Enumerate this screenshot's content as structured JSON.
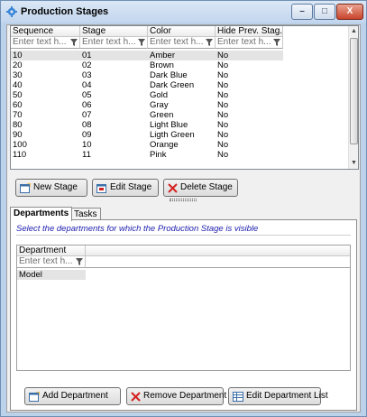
{
  "window": {
    "title": "Production Stages",
    "minimize_glyph": "–",
    "maximize_glyph": "□",
    "close_glyph": "X"
  },
  "stages_grid": {
    "columns": [
      "Sequence",
      "Stage",
      "Color",
      "Hide Prev. Stag..."
    ],
    "filter_placeholder": "Enter text h...",
    "rows": [
      [
        "10",
        "01",
        "Amber",
        "No"
      ],
      [
        "20",
        "02",
        "Brown",
        "No"
      ],
      [
        "30",
        "03",
        "Dark Blue",
        "No"
      ],
      [
        "40",
        "04",
        "Dark Green",
        "No"
      ],
      [
        "50",
        "05",
        "Gold",
        "No"
      ],
      [
        "60",
        "06",
        "Gray",
        "No"
      ],
      [
        "70",
        "07",
        "Green",
        "No"
      ],
      [
        "80",
        "08",
        "Light Blue",
        "No"
      ],
      [
        "90",
        "09",
        "Ligth Green",
        "No"
      ],
      [
        "100",
        "10",
        "Orange",
        "No"
      ]
    ],
    "partial_row": [
      "110",
      "11",
      "Pink",
      "No"
    ]
  },
  "stage_buttons": {
    "new": "New Stage",
    "edit": "Edit Stage",
    "delete": "Delete Stage"
  },
  "tabs": [
    "Departments",
    "Tasks"
  ],
  "departments": {
    "hint": "Select the departments for which the Production Stage is visible",
    "column": "Department",
    "filter_placeholder": "Enter text h...",
    "rows": [
      "Model"
    ]
  },
  "department_buttons": {
    "add": "Add Department",
    "remove": "Remove Department",
    "edit_list": "Edit Department List"
  },
  "icons": {
    "app": "gear-icon",
    "filter": "funnel-icon",
    "new": "new-document-icon",
    "edit": "edit-window-icon",
    "delete": "red-x-icon",
    "add_dept": "new-document-icon",
    "remove_dept": "red-x-icon",
    "edit_list": "grid-list-icon"
  },
  "colors": {
    "title_bar": "#c3d6ee",
    "hint_text": "#2020b0",
    "delete_red": "#d42020",
    "selected_row": "#e4e4e4"
  }
}
